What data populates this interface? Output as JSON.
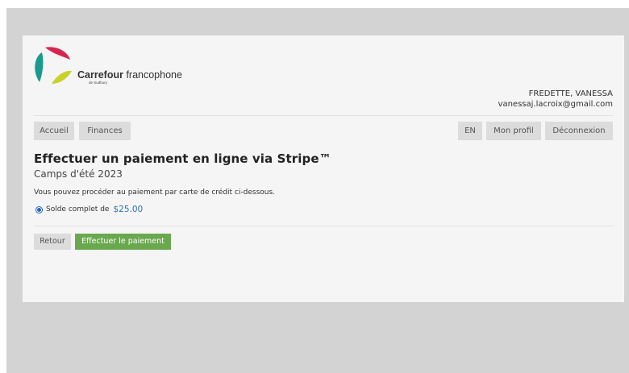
{
  "brand": {
    "name_bold": "Carrefour",
    "name_regular": " francophone",
    "tagline": "de Sudbury",
    "colors": {
      "red": "#d6264f",
      "teal": "#1a9a8e",
      "yellow": "#c9d12a"
    }
  },
  "user": {
    "name": "FREDETTE, VANESSA",
    "email": "vanessaj.lacroix@gmail.com"
  },
  "nav": {
    "left": [
      {
        "label": "Accueil"
      },
      {
        "label": "Finances"
      }
    ],
    "right": [
      {
        "label": "EN"
      },
      {
        "label": "Mon profil"
      },
      {
        "label": "Déconnexion"
      }
    ]
  },
  "page": {
    "title": "Effectuer un paiement en ligne via Stripe™",
    "subtitle": "Camps d'été 2023",
    "instruction": "Vous pouvez procéder au paiement par carte de crédit ci-dessous."
  },
  "payment_option": {
    "label": "Solde complet de",
    "amount": "$25.00",
    "selected": true
  },
  "actions": {
    "back_label": "Retour",
    "pay_label": "Effectuer le paiement"
  },
  "colors": {
    "backdrop": "#d3d3d3",
    "card": "#f5f5f5",
    "button_grey": "#dcdcdc",
    "pay_green": "#6aa84f",
    "amount_blue": "#2e6fb3",
    "radio_blue": "#1f64c8"
  }
}
